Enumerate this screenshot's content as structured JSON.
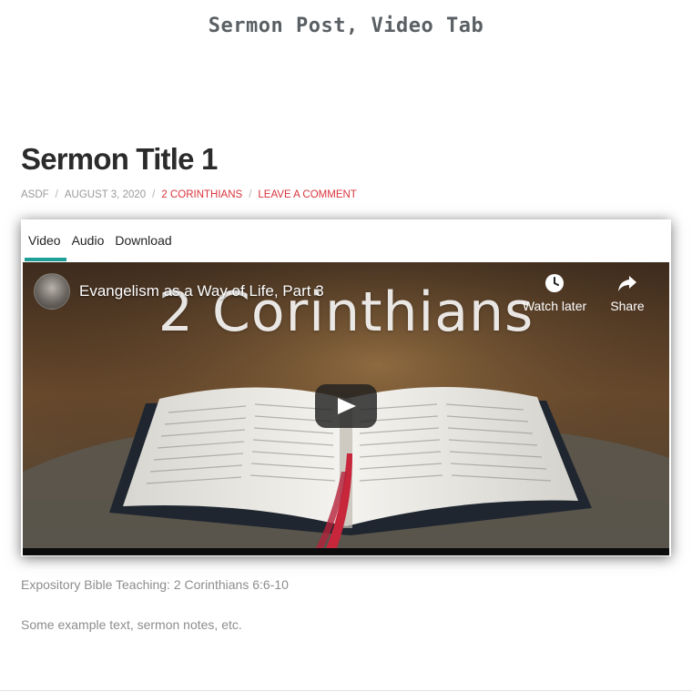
{
  "site": {
    "title": "Sermon Post, Video Tab"
  },
  "post": {
    "title": "Sermon Title 1",
    "meta": {
      "author": "ASDF",
      "date": "AUGUST 3, 2020",
      "category": "2 CORINTHIANS",
      "comment_link": "LEAVE A COMMENT",
      "separator": "/"
    },
    "tabs": [
      {
        "label": "Video",
        "active": true
      },
      {
        "label": "Audio",
        "active": false
      },
      {
        "label": "Download",
        "active": false
      }
    ],
    "video": {
      "title": "Evangelism as a Way of Life, Part 3",
      "overlay_heading": "2 Corinthians",
      "watch_later_label": "Watch later",
      "share_label": "Share",
      "icons": [
        "clock-icon",
        "share-arrow-icon",
        "play-icon"
      ]
    },
    "description": "Expository Bible Teaching: 2 Corinthians 6:6-10",
    "notes": "Some example text, sermon notes, etc."
  },
  "colors": {
    "accent": "#d8343c",
    "tab_underline": "#1f9e98",
    "muted_text": "#8d8d8d"
  }
}
